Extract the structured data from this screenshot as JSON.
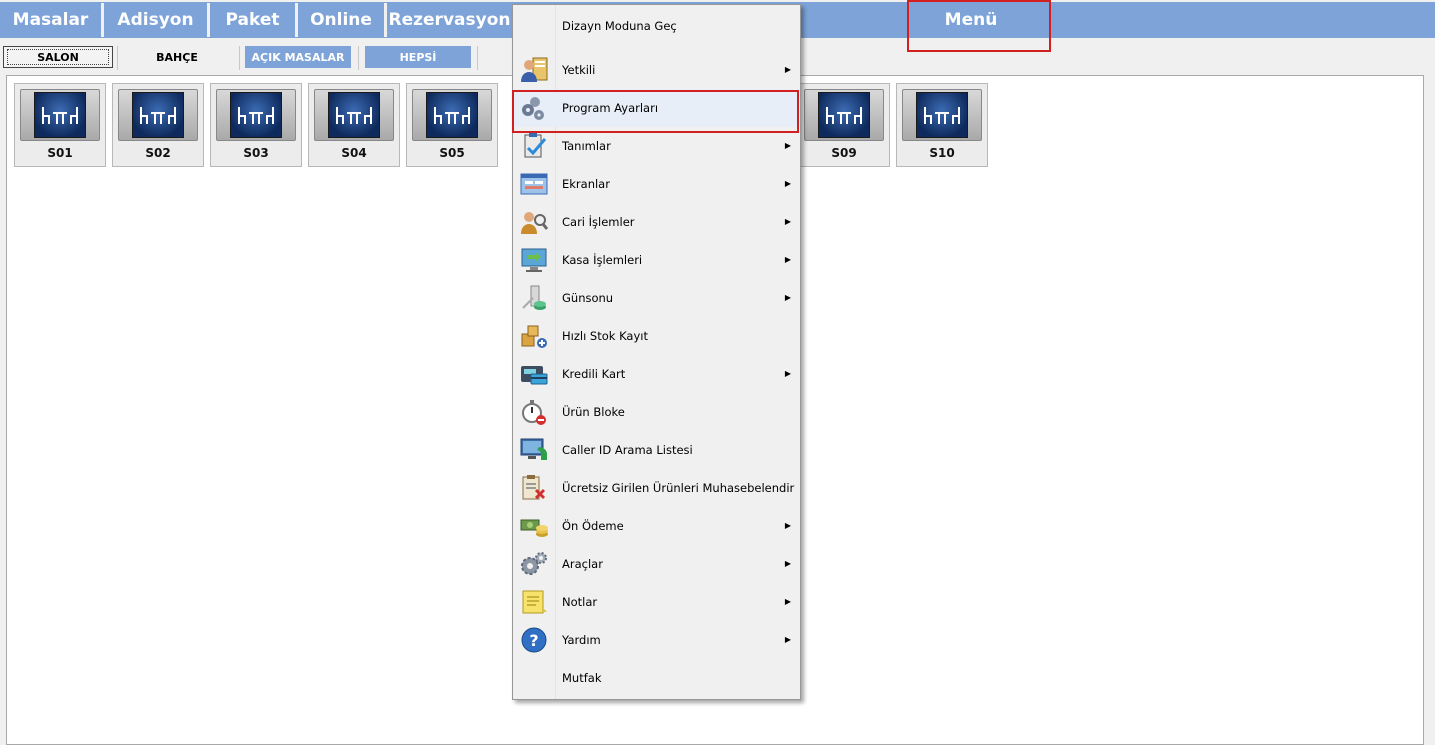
{
  "topbar": {
    "tabs": [
      {
        "label": "Masalar"
      },
      {
        "label": "Adisyon"
      },
      {
        "label": "Paket"
      },
      {
        "label": "Online"
      },
      {
        "label": "Rezervasyon"
      }
    ],
    "menu_label": "Menü"
  },
  "areas": [
    {
      "label": "SALON",
      "selected": true
    },
    {
      "label": "BAHÇE",
      "selected": false
    },
    {
      "label": "AÇIK MASALAR",
      "selected": false
    },
    {
      "label": "HEPSİ",
      "selected": false
    }
  ],
  "tables": [
    {
      "label": "S01"
    },
    {
      "label": "S02"
    },
    {
      "label": "S03"
    },
    {
      "label": "S04"
    },
    {
      "label": "S05"
    },
    {
      "label": "S09"
    },
    {
      "label": "S10"
    }
  ],
  "context_menu": {
    "items": [
      {
        "label": "Dizayn Moduna Geç",
        "icon": "none",
        "submenu": false
      },
      {
        "label": "Yetkili",
        "icon": "user-clipboard-icon",
        "submenu": true
      },
      {
        "label": "Program Ayarları",
        "icon": "gears-user-icon",
        "submenu": false,
        "highlighted": true
      },
      {
        "label": "Tanımlar",
        "icon": "clipboard-check-icon",
        "submenu": true
      },
      {
        "label": "Ekranlar",
        "icon": "screen-window-icon",
        "submenu": true
      },
      {
        "label": "Cari İşlemler",
        "icon": "user-search-icon",
        "submenu": true
      },
      {
        "label": "Kasa İşlemleri",
        "icon": "monitor-arrow-icon",
        "submenu": true
      },
      {
        "label": "Günsonu",
        "icon": "day-end-icon",
        "submenu": true
      },
      {
        "label": "Hızlı Stok Kayıt",
        "icon": "boxes-add-icon",
        "submenu": false
      },
      {
        "label": "Kredili Kart",
        "icon": "card-terminal-icon",
        "submenu": true
      },
      {
        "label": "Ürün Bloke",
        "icon": "stopwatch-block-icon",
        "submenu": false
      },
      {
        "label": "Caller ID Arama Listesi",
        "icon": "phone-monitor-icon",
        "submenu": false
      },
      {
        "label": "Ücretsiz Girilen Ürünleri Muhasebelendir",
        "icon": "clipboard-x-icon",
        "submenu": false
      },
      {
        "label": "Ön Ödeme",
        "icon": "money-coins-icon",
        "submenu": true
      },
      {
        "label": "Araçlar",
        "icon": "gears-icon",
        "submenu": true
      },
      {
        "label": "Notlar",
        "icon": "notes-icon",
        "submenu": true
      },
      {
        "label": "Yardım",
        "icon": "help-question-icon",
        "submenu": true
      },
      {
        "label": "Mutfak",
        "icon": "none",
        "submenu": false
      }
    ],
    "arrow_glyph": "▶"
  },
  "colors": {
    "accent_blue": "#7da3d8",
    "highlight_red": "#d21f1f"
  }
}
